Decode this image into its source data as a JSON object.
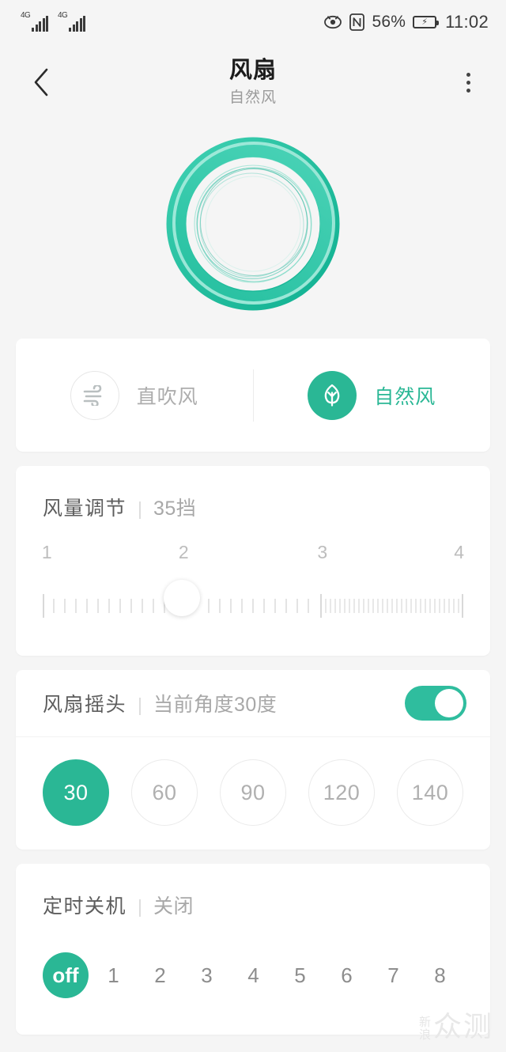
{
  "status_bar": {
    "network_label": "4G",
    "network_label_2": "4G",
    "battery_percent": "56%",
    "time": "11:02",
    "icons": [
      "signal-4g-icon",
      "signal-4g-icon",
      "eye-care-icon",
      "nfc-icon",
      "battery-charging-icon"
    ]
  },
  "app_bar": {
    "back_icon": "back-chevron-icon",
    "title": "风扇",
    "subtitle": "自然风",
    "menu_icon": "more-vertical-icon"
  },
  "fan_visual": {
    "name": "fan-ring-animation",
    "ring_color": "#24bd9e",
    "ring_color_light": "#3ecdb0"
  },
  "mode_card": {
    "options": [
      {
        "icon": "wind-icon",
        "label": "直吹风",
        "active": false
      },
      {
        "icon": "leaf-icon",
        "label": "自然风",
        "active": true
      }
    ]
  },
  "wind_card": {
    "title": "风量调节",
    "separator": "|",
    "value": "35挡",
    "scale_labels": [
      "1",
      "2",
      "3",
      "4"
    ],
    "slider_value": 35,
    "slider_min": 1,
    "slider_max": 100,
    "thumb_percent": 33
  },
  "oscillation_card": {
    "title": "风扇摇头",
    "separator": "|",
    "value": "当前角度30度",
    "toggle_on": true,
    "angles": [
      {
        "label": "30",
        "active": true
      },
      {
        "label": "60",
        "active": false
      },
      {
        "label": "90",
        "active": false
      },
      {
        "label": "120",
        "active": false
      },
      {
        "label": "140",
        "active": false
      }
    ]
  },
  "timer_card": {
    "title": "定时关机",
    "separator": "|",
    "value": "关闭",
    "options": [
      {
        "label": "off",
        "active": true
      },
      {
        "label": "1",
        "active": false
      },
      {
        "label": "2",
        "active": false
      },
      {
        "label": "3",
        "active": false
      },
      {
        "label": "4",
        "active": false
      },
      {
        "label": "5",
        "active": false
      },
      {
        "label": "6",
        "active": false
      },
      {
        "label": "7",
        "active": false
      },
      {
        "label": "8",
        "active": false
      }
    ]
  },
  "watermark": {
    "small": "新浪",
    "big": "众测"
  },
  "colors": {
    "accent": "#2ab795",
    "accent_toggle": "#2fbd9e",
    "bg": "#f5f5f5",
    "card": "#ffffff"
  }
}
